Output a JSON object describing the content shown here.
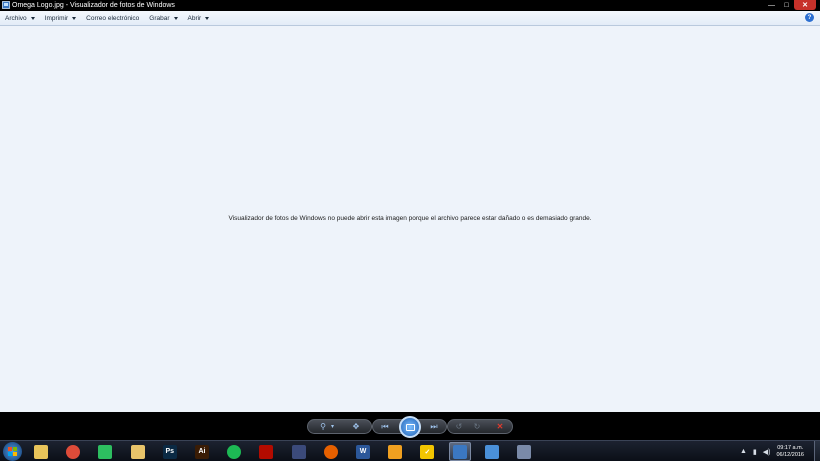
{
  "window": {
    "title": "Omega Logo.jpg - Visualizador de fotos de Windows",
    "minimize_glyph": "—",
    "maximize_glyph": "□",
    "close_glyph": "✕"
  },
  "menu": {
    "items": [
      {
        "label": "Archivo",
        "has_arrow": true
      },
      {
        "label": "Imprimir",
        "has_arrow": true
      },
      {
        "label": "Correo electrónico",
        "has_arrow": false
      },
      {
        "label": "Grabar",
        "has_arrow": true
      },
      {
        "label": "Abrir",
        "has_arrow": true
      }
    ],
    "help_glyph": "?"
  },
  "viewer": {
    "message": "Visualizador de fotos de Windows no puede abrir esta imagen porque el archivo parece estar dañado o es demasiado grande."
  },
  "controls": {
    "zoom_glyph": "⚲",
    "zoom_arrow": "▾",
    "actual_size_glyph": "✥",
    "previous_glyph": "⏮",
    "next_glyph": "⏭",
    "rotate_ccw_glyph": "↺",
    "rotate_cw_glyph": "↻",
    "delete_glyph": "✕"
  },
  "taskbar": {
    "clock_time": "09:17 a.m.",
    "clock_date": "06/12/2016",
    "tray_arrow": "▲",
    "icons": [
      {
        "name": "windows-explorer-icon",
        "color": "#e8c45a",
        "text": ""
      },
      {
        "name": "chrome-icon",
        "color": "#dd4b39",
        "text": ""
      },
      {
        "name": "evernote-icon",
        "color": "#2dbe60",
        "text": ""
      },
      {
        "name": "folder-icon",
        "color": "#e9c46a",
        "text": ""
      },
      {
        "name": "photoshop-icon",
        "color": "#0b2a44",
        "text": "Ps"
      },
      {
        "name": "illustrator-icon",
        "color": "#3a1c05",
        "text": "Ai"
      },
      {
        "name": "spotify-icon",
        "color": "#1db954",
        "text": ""
      },
      {
        "name": "acrobat-icon",
        "color": "#b30b00",
        "text": ""
      },
      {
        "name": "media-encoder-icon",
        "color": "#3b4a7a",
        "text": ""
      },
      {
        "name": "firefox-icon",
        "color": "#e66000",
        "text": ""
      },
      {
        "name": "word-icon",
        "color": "#2b579a",
        "text": "W"
      },
      {
        "name": "gamepad-icon",
        "color": "#f0a020",
        "text": ""
      },
      {
        "name": "norton-icon",
        "color": "#f2c500",
        "text": "✓"
      },
      {
        "name": "photo-viewer-icon",
        "color": "#3b78c2",
        "text": ""
      },
      {
        "name": "network-icon",
        "color": "#4a90d9",
        "text": ""
      },
      {
        "name": "remote-desktop-icon",
        "color": "#7a8aa8",
        "text": ""
      }
    ]
  }
}
